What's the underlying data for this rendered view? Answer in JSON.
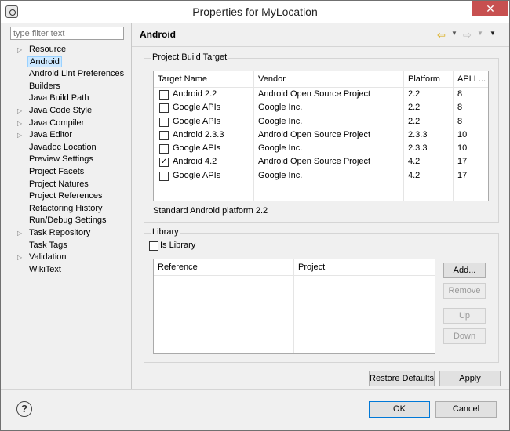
{
  "window": {
    "title": "Properties for MyLocation",
    "close_label": "✕"
  },
  "filter": {
    "placeholder": "type filter text"
  },
  "tree": [
    {
      "label": "Resource",
      "expandable": true
    },
    {
      "label": "Android",
      "expandable": false,
      "selected": true
    },
    {
      "label": "Android Lint Preferences",
      "expandable": false
    },
    {
      "label": "Builders",
      "expandable": false
    },
    {
      "label": "Java Build Path",
      "expandable": false
    },
    {
      "label": "Java Code Style",
      "expandable": true
    },
    {
      "label": "Java Compiler",
      "expandable": true
    },
    {
      "label": "Java Editor",
      "expandable": true
    },
    {
      "label": "Javadoc Location",
      "expandable": false
    },
    {
      "label": "Preview Settings",
      "expandable": false
    },
    {
      "label": "Project Facets",
      "expandable": false
    },
    {
      "label": "Project Natures",
      "expandable": false
    },
    {
      "label": "Project References",
      "expandable": false
    },
    {
      "label": "Refactoring History",
      "expandable": false
    },
    {
      "label": "Run/Debug Settings",
      "expandable": false
    },
    {
      "label": "Task Repository",
      "expandable": true
    },
    {
      "label": "Task Tags",
      "expandable": false
    },
    {
      "label": "Validation",
      "expandable": true
    },
    {
      "label": "WikiText",
      "expandable": false
    }
  ],
  "page": {
    "title": "Android"
  },
  "build_target": {
    "group_label": "Project Build Target",
    "columns": [
      "Target Name",
      "Vendor",
      "Platform",
      "API L..."
    ],
    "rows": [
      {
        "name": "Android 2.2",
        "vendor": "Android Open Source Project",
        "platform": "2.2",
        "api": "8",
        "checked": false
      },
      {
        "name": "Google APIs",
        "vendor": "Google Inc.",
        "platform": "2.2",
        "api": "8",
        "checked": false
      },
      {
        "name": "Google APIs",
        "vendor": "Google Inc.",
        "platform": "2.2",
        "api": "8",
        "checked": false
      },
      {
        "name": "Android 2.3.3",
        "vendor": "Android Open Source Project",
        "platform": "2.3.3",
        "api": "10",
        "checked": false
      },
      {
        "name": "Google APIs",
        "vendor": "Google Inc.",
        "platform": "2.3.3",
        "api": "10",
        "checked": false
      },
      {
        "name": "Android 4.2",
        "vendor": "Android Open Source Project",
        "platform": "4.2",
        "api": "17",
        "checked": true
      },
      {
        "name": "Google APIs",
        "vendor": "Google Inc.",
        "platform": "4.2",
        "api": "17",
        "checked": false
      }
    ],
    "description": "Standard Android platform 2.2"
  },
  "library": {
    "group_label": "Library",
    "is_library_label": "Is Library",
    "is_library_checked": false,
    "columns": [
      "Reference",
      "Project"
    ],
    "buttons": {
      "add": "Add...",
      "remove": "Remove",
      "up": "Up",
      "down": "Down"
    }
  },
  "buttons": {
    "restore_defaults": "Restore Defaults",
    "apply": "Apply",
    "ok": "OK",
    "cancel": "Cancel",
    "help": "?"
  }
}
